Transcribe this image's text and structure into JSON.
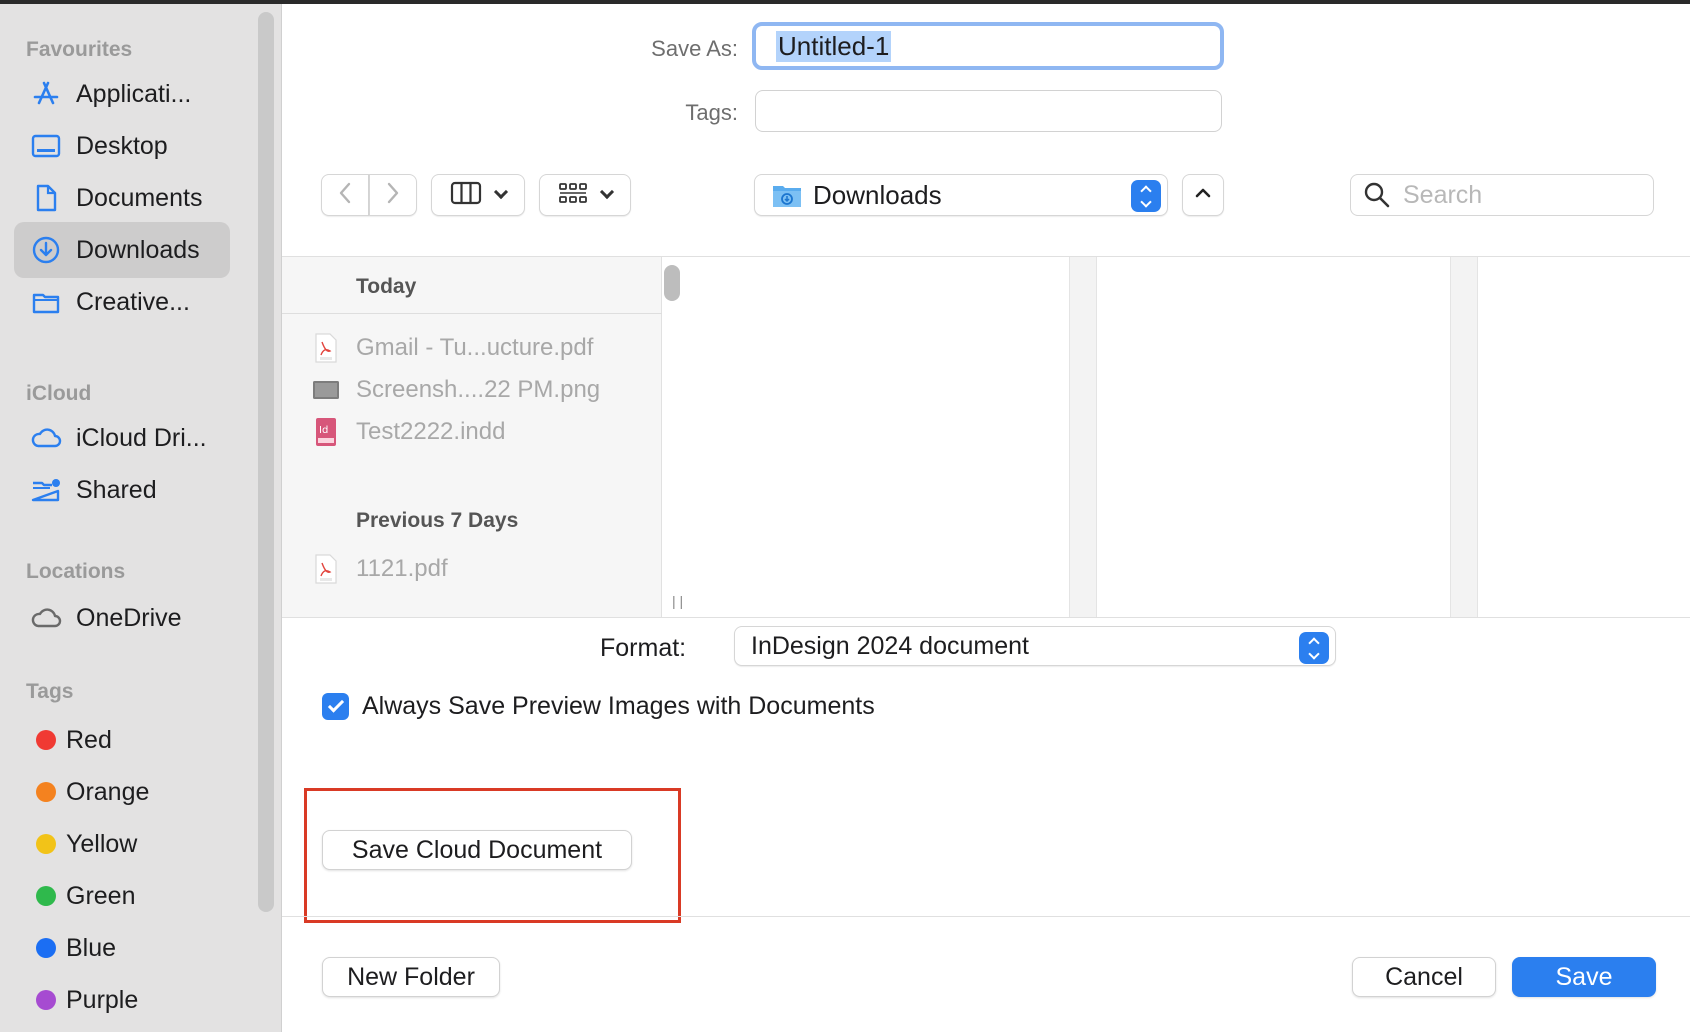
{
  "sidebar": {
    "sections": {
      "favourites": "Favourites",
      "icloud": "iCloud",
      "locations": "Locations",
      "tags": "Tags"
    },
    "favourites": [
      {
        "label": "Applicati...",
        "icon": "applications-icon"
      },
      {
        "label": "Desktop",
        "icon": "desktop-icon"
      },
      {
        "label": "Documents",
        "icon": "document-icon"
      },
      {
        "label": "Downloads",
        "icon": "downloads-icon",
        "selected": true
      },
      {
        "label": "Creative...",
        "icon": "folder-icon"
      }
    ],
    "icloud": [
      {
        "label": "iCloud Dri...",
        "icon": "icloud-icon"
      },
      {
        "label": "Shared",
        "icon": "shared-folder-icon"
      }
    ],
    "locations": [
      {
        "label": "OneDrive",
        "icon": "cloud-icon"
      }
    ],
    "tags": [
      {
        "label": "Red",
        "color": "#f03a33"
      },
      {
        "label": "Orange",
        "color": "#f4821f"
      },
      {
        "label": "Yellow",
        "color": "#f2c318"
      },
      {
        "label": "Green",
        "color": "#2fb94c"
      },
      {
        "label": "Blue",
        "color": "#1b6ef3"
      },
      {
        "label": "Purple",
        "color": "#a64bd1"
      }
    ]
  },
  "save_as": {
    "label": "Save As:",
    "value": "Untitled-1"
  },
  "tags_field": {
    "label": "Tags:",
    "value": ""
  },
  "location": {
    "current": "Downloads"
  },
  "search": {
    "placeholder": "Search"
  },
  "browser": {
    "groups": [
      {
        "heading": "Today",
        "files": [
          {
            "name": "Gmail - Tu...ucture.pdf",
            "icon": "pdf-file-icon"
          },
          {
            "name": "Screensh....22 PM.png",
            "icon": "image-file-icon"
          },
          {
            "name": "Test2222.indd",
            "icon": "indesign-file-icon"
          }
        ]
      },
      {
        "heading": "Previous 7 Days",
        "files": [
          {
            "name": "1121.pdf",
            "icon": "pdf-file-icon"
          }
        ]
      }
    ]
  },
  "format": {
    "label": "Format:",
    "value": "InDesign 2024 document"
  },
  "preview_checkbox": {
    "label": "Always Save Preview Images with Documents",
    "checked": true
  },
  "buttons": {
    "save_cloud": "Save Cloud Document",
    "new_folder": "New Folder",
    "cancel": "Cancel",
    "save": "Save"
  },
  "colors": {
    "accent": "#2b7fef",
    "highlight_box": "#d93a25"
  }
}
